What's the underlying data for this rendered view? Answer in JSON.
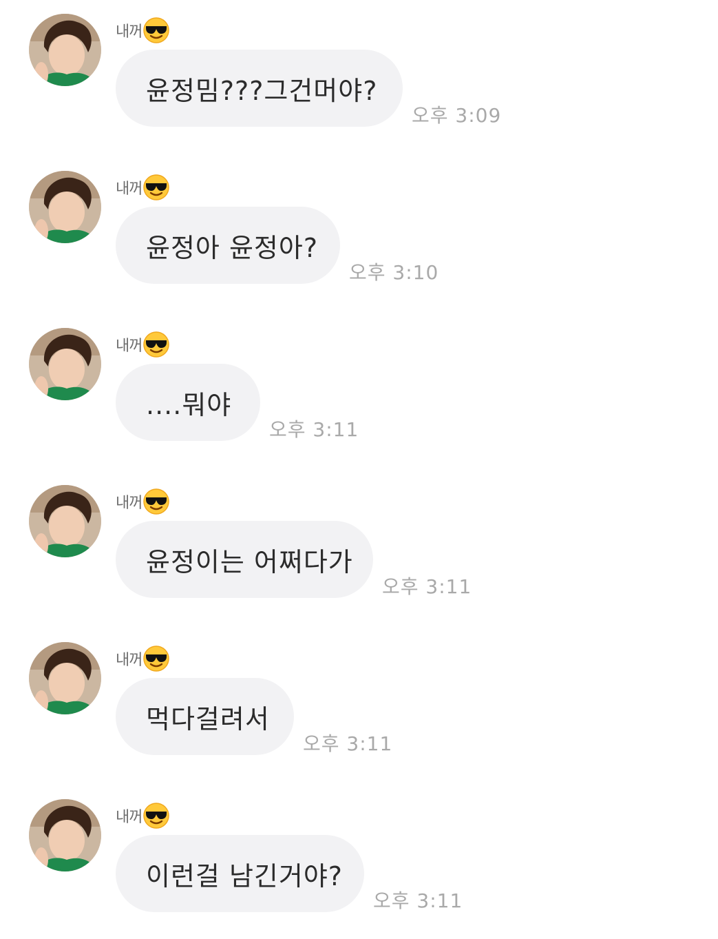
{
  "chat": {
    "messages": [
      {
        "sender": "내꺼",
        "sender_emoji": "smiling-face-with-sunglasses",
        "text": "윤정밈???그건머야?",
        "time": "오후 3:09"
      },
      {
        "sender": "내꺼",
        "sender_emoji": "smiling-face-with-sunglasses",
        "text": "윤정아 윤정아?",
        "time": "오후 3:10"
      },
      {
        "sender": "내꺼",
        "sender_emoji": "smiling-face-with-sunglasses",
        "text": "....뭐야",
        "time": "오후 3:11"
      },
      {
        "sender": "내꺼",
        "sender_emoji": "smiling-face-with-sunglasses",
        "text": "윤정이는 어쩌다가",
        "time": "오후 3:11"
      },
      {
        "sender": "내꺼",
        "sender_emoji": "smiling-face-with-sunglasses",
        "text": "먹다걸려서",
        "time": "오후 3:11"
      },
      {
        "sender": "내꺼",
        "sender_emoji": "smiling-face-with-sunglasses",
        "text": "이런걸 남긴거야?",
        "time": "오후 3:11"
      }
    ]
  },
  "colors": {
    "bubble": "#f2f2f4",
    "text": "#2b2b2b",
    "time": "#a9a9a9",
    "sender": "#6d6d6d"
  }
}
